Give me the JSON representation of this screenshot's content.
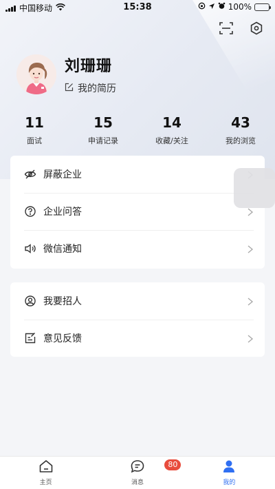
{
  "status_bar": {
    "carrier": "中国移动",
    "time": "15:38",
    "battery": "100%",
    "icons": [
      "signal-icon",
      "wifi-icon",
      "lock-rotation-icon",
      "location-icon",
      "alarm-icon",
      "battery-icon"
    ]
  },
  "header": {
    "icons": [
      "scan-icon",
      "settings-icon"
    ]
  },
  "profile": {
    "name": "刘珊珊",
    "resume_label": "我的简历"
  },
  "stats": [
    {
      "value": "11",
      "label": "面试"
    },
    {
      "value": "15",
      "label": "申请记录"
    },
    {
      "value": "14",
      "label": "收藏/关注"
    },
    {
      "value": "43",
      "label": "我的浏览"
    }
  ],
  "menu_group1": [
    {
      "label": "屏蔽企业",
      "icon": "eye-off-icon"
    },
    {
      "label": "企业问答",
      "icon": "question-icon"
    },
    {
      "label": "微信通知",
      "icon": "speaker-icon"
    }
  ],
  "menu_group2": [
    {
      "label": "我要招人",
      "icon": "recruit-icon"
    },
    {
      "label": "意见反馈",
      "icon": "feedback-icon"
    }
  ],
  "tabbar": {
    "tabs": [
      {
        "label": "主页",
        "icon": "home-icon"
      },
      {
        "label": "消息",
        "icon": "message-icon",
        "badge": "80"
      },
      {
        "label": "我的",
        "icon": "user-icon"
      }
    ],
    "active_color": "#2f6ff2",
    "badge_color": "#e84c3d"
  }
}
